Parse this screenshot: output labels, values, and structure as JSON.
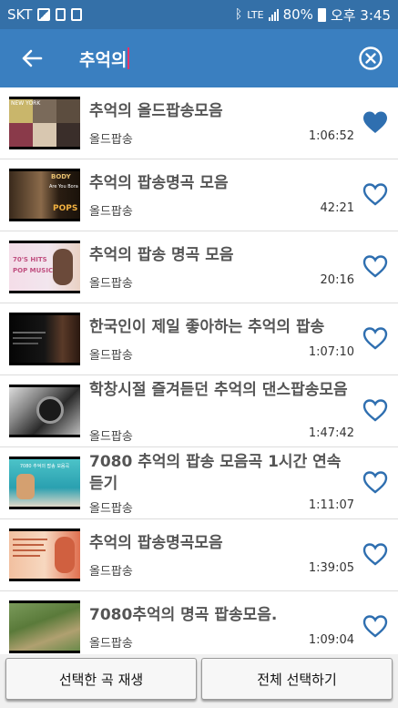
{
  "status_bar": {
    "carrier": "SKT",
    "network": "LTE",
    "battery": "80%",
    "time": "오후 3:45",
    "icons": [
      "photo-icon",
      "document-icon",
      "alarm-icon",
      "bluetooth-icon",
      "signal-icon",
      "battery-icon"
    ]
  },
  "search": {
    "query": "추억의",
    "back_icon": "arrow-left-icon",
    "clear_icon": "close-circle-icon"
  },
  "accent_color": "#3a7fc0",
  "songs": [
    {
      "title": "추억의 올드팝송모음",
      "channel": "올드팝송",
      "duration": "1:06:52",
      "favorited": true
    },
    {
      "title": "추억의 팝송명곡 모음",
      "channel": "올드팝송",
      "duration": "42:21",
      "favorited": false
    },
    {
      "title": "추억의 팝송 명곡 모음",
      "channel": "올드팝송",
      "duration": "20:16",
      "favorited": false
    },
    {
      "title": "한국인이 제일 좋아하는 추억의 팝송",
      "channel": "올드팝송",
      "duration": "1:07:10",
      "favorited": false
    },
    {
      "title": "학창시절 즐겨듣던 추억의 댄스팝송모음",
      "channel": "올드팝송",
      "duration": "1:47:42",
      "favorited": false
    },
    {
      "title": "7080 추억의 팝송 모음곡 1시간 연속듣기",
      "channel": "올드팝송",
      "duration": "1:11:07",
      "favorited": false
    },
    {
      "title": "추억의 팝송명곡모음",
      "channel": "올드팝송",
      "duration": "1:39:05",
      "favorited": false
    },
    {
      "title": "7080추억의  명곡 팝송모음.",
      "channel": "올드팝송",
      "duration": "1:09:04",
      "favorited": false
    }
  ],
  "thumbnails": {
    "t1": "NEW YORK",
    "t2a": "BODY",
    "t2b": "Are You Bora",
    "t2c": "POPS",
    "t3a": "70'S HITS",
    "t3b": "POP MUSIC",
    "t6": "7080 추억의 팝송 모음곡"
  },
  "buttons": {
    "play_selected": "선택한 곡 재생",
    "select_all": "전체 선택하기"
  }
}
